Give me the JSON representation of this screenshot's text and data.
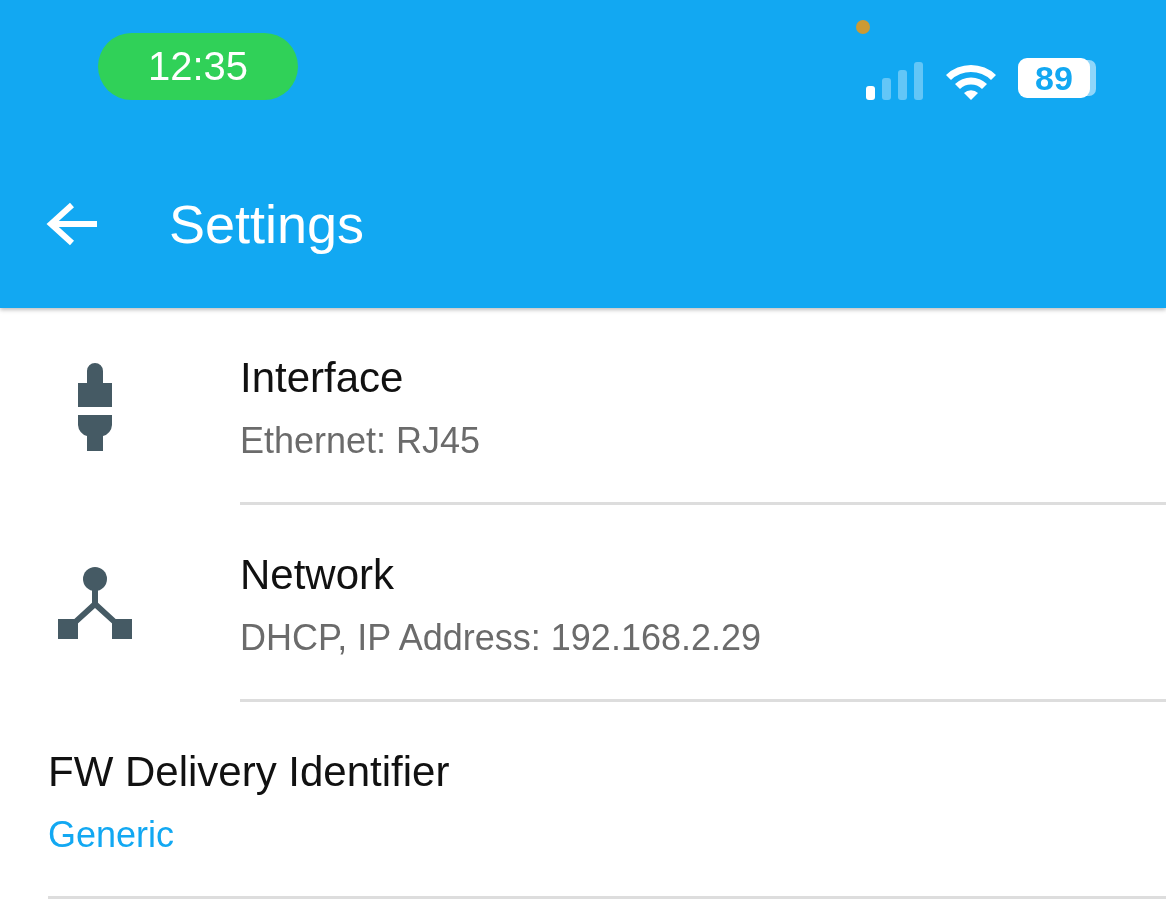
{
  "status_bar": {
    "time": "12:35",
    "battery": "89"
  },
  "app_bar": {
    "title": "Settings"
  },
  "settings": [
    {
      "kind": "ethernet",
      "title": "Interface",
      "value": "Ethernet: RJ45"
    },
    {
      "kind": "network",
      "title": "Network",
      "value": "DHCP, IP Address: 192.168.2.29"
    },
    {
      "kind": "plain",
      "title": "FW Delivery Identifier",
      "value": "Generic"
    }
  ]
}
